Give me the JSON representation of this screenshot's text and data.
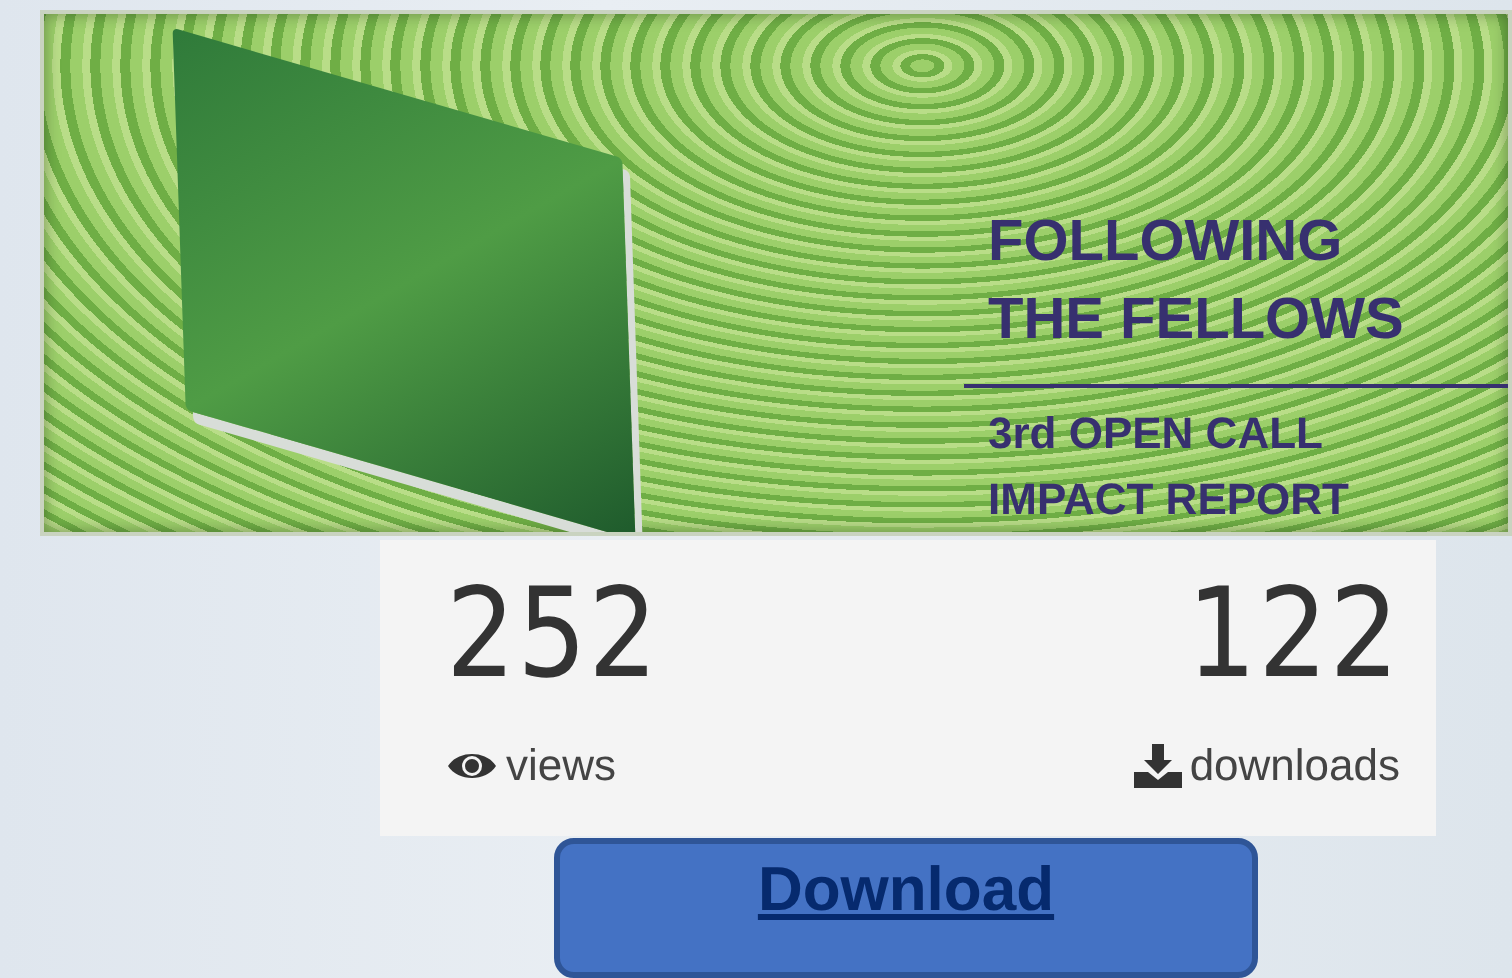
{
  "banner": {
    "headline": [
      "FOLLOWING",
      "THE FELLOWS"
    ],
    "subline": [
      "3rd OPEN CALL",
      "IMPACT REPORT"
    ]
  },
  "stats": [
    {
      "kind": "views",
      "count": "252",
      "label": "views"
    },
    {
      "kind": "downloads",
      "count": "122",
      "label": "downloads"
    }
  ],
  "download_button": {
    "label": "Download"
  }
}
